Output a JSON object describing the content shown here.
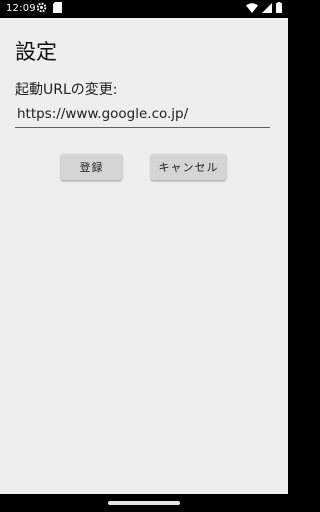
{
  "status_bar": {
    "time": "12:09",
    "left_icons": [
      "settings-gear-icon",
      "sd-card-icon"
    ],
    "right_icons": [
      "wifi-icon",
      "cellular-signal-icon",
      "battery-icon"
    ]
  },
  "screen": {
    "title": "設定",
    "url_label": "起動URLの変更:",
    "url_value": "https://www.google.co.jp/",
    "register_button": "登録",
    "cancel_button": "キャンセル"
  },
  "colors": {
    "background": "#eeeeee",
    "button": "#d5d5d5",
    "bars": "#000000"
  }
}
